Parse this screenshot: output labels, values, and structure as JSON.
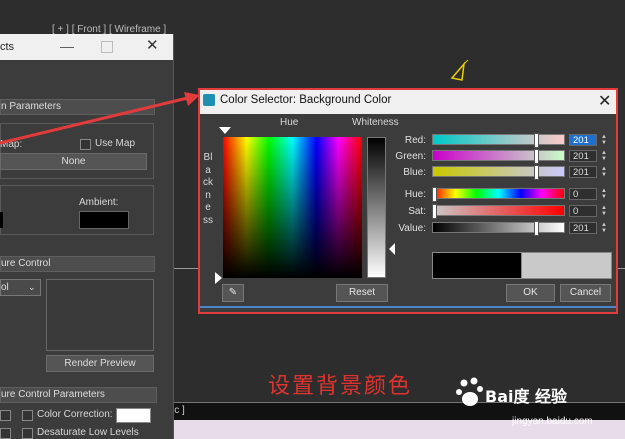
{
  "viewport": {
    "label": "[ + ] [ Front ] [ Wireframe ]",
    "bottom_text": "ic ]"
  },
  "left_window": {
    "title": "cts",
    "rollout_parameters": "n Parameters",
    "map_label": "Map:",
    "use_map_label": "Use Map",
    "none_button": "None",
    "ambient_label": "Ambient:",
    "exposure_control": "ure Control",
    "dropdown_value": "ol",
    "render_preview": "Render Preview",
    "exposure_params": "ure Control Parameters",
    "color_correction": "Color Correction:",
    "desaturate": "Desaturate Low Levels"
  },
  "dialog": {
    "title": "Color Selector: Background Color",
    "hue_header": "Hue",
    "whiteness_header": "Whiteness",
    "blackness_label": "Blackness",
    "rows": [
      {
        "label": "Red:",
        "value": "201"
      },
      {
        "label": "Green:",
        "value": "201"
      },
      {
        "label": "Blue:",
        "value": "201"
      },
      {
        "label": "Hue:",
        "value": "0"
      },
      {
        "label": "Sat:",
        "value": "0"
      },
      {
        "label": "Value:",
        "value": "201"
      }
    ],
    "reset_button": "Reset",
    "ok_button": "OK",
    "cancel_button": "Cancel",
    "old_color": "#000000",
    "new_color": "#c9c9c9"
  },
  "annotation": {
    "caption": "设置背景颜色",
    "arrow_color": "#e23b3b"
  },
  "watermark": {
    "brand": "Bai度 经验",
    "url": "jingyan.baidu.com"
  }
}
